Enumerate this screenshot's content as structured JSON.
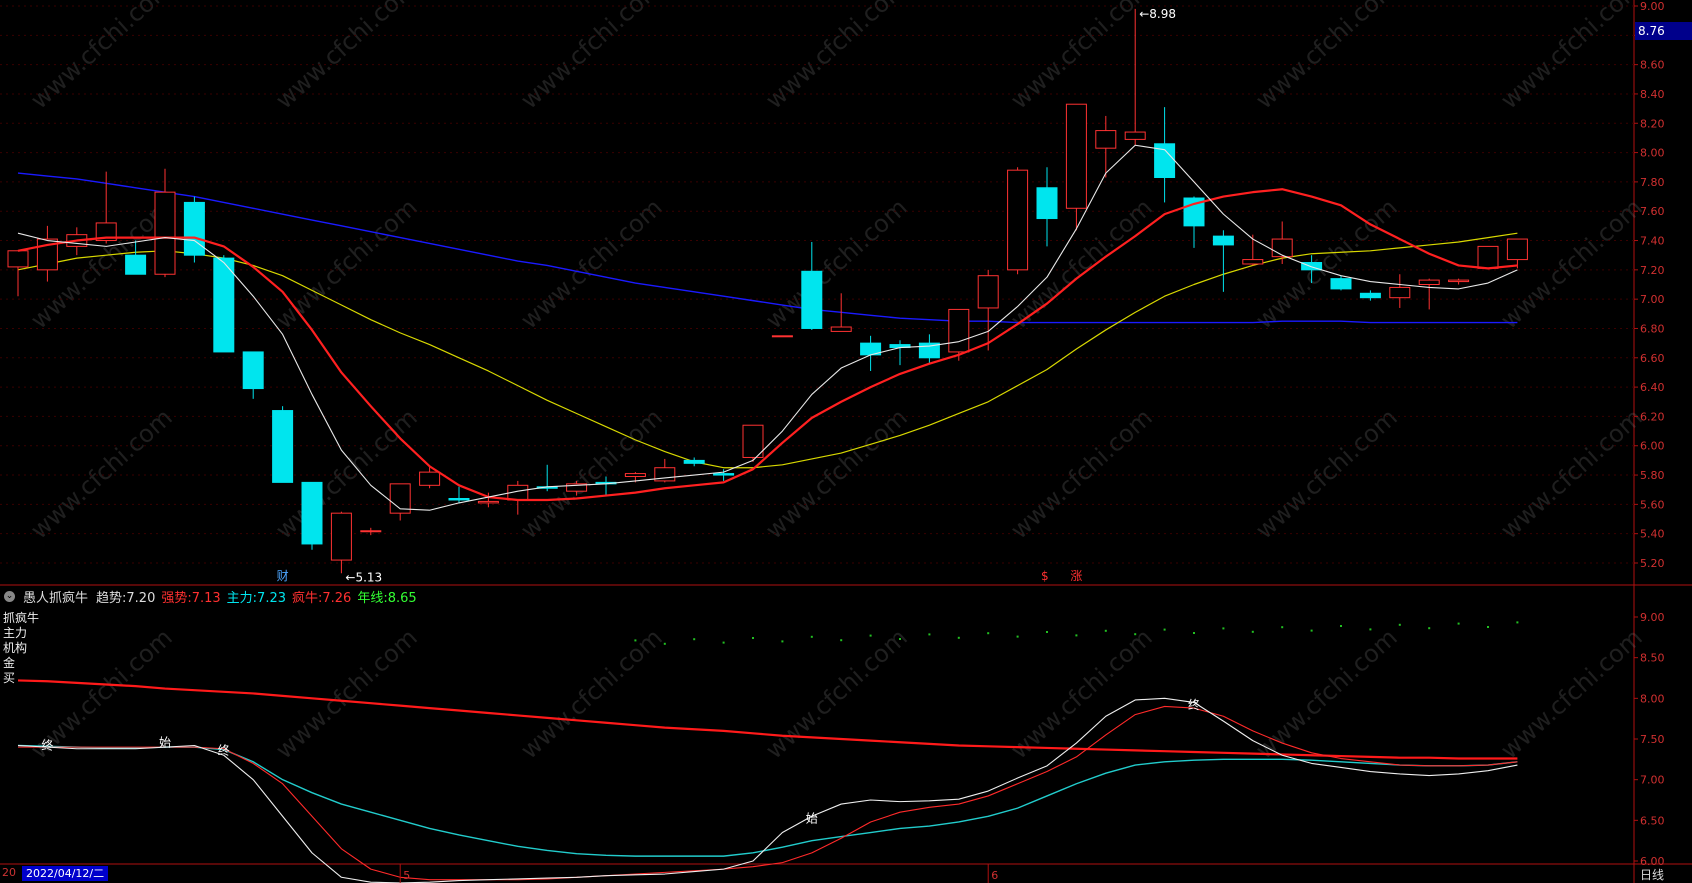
{
  "chart_data": [
    {
      "type": "candlestick",
      "period": "日线",
      "ylim": [
        5.0,
        9.0
      ],
      "y_ticks": [
        "9.00",
        "8.80",
        "8.60",
        "8.40",
        "8.20",
        "8.00",
        "7.80",
        "7.60",
        "7.40",
        "7.20",
        "7.00",
        "6.80",
        "6.60",
        "6.40",
        "6.20",
        "6.00",
        "5.80",
        "5.60",
        "5.40",
        "5.20"
      ],
      "current_price": "8.76",
      "colors": {
        "up": "#ff3232",
        "down": "#00e5ee",
        "ma_white": "#e8e8e8",
        "ma_red": "#ff2020",
        "ma_yellow": "#d8d800",
        "ma_blue": "#1a1aff",
        "axis": "#b01010"
      },
      "candles": [
        {
          "o": 7.22,
          "h": 7.33,
          "l": 7.02,
          "c": 7.33
        },
        {
          "o": 7.2,
          "h": 7.5,
          "l": 7.12,
          "c": 7.41
        },
        {
          "o": 7.36,
          "h": 7.49,
          "l": 7.3,
          "c": 7.44
        },
        {
          "o": 7.4,
          "h": 7.87,
          "l": 7.38,
          "c": 7.52
        },
        {
          "o": 7.3,
          "h": 7.4,
          "l": 7.17,
          "c": 7.17
        },
        {
          "o": 7.17,
          "h": 7.89,
          "l": 7.15,
          "c": 7.73
        },
        {
          "o": 7.66,
          "h": 7.7,
          "l": 7.25,
          "c": 7.3
        },
        {
          "o": 7.28,
          "h": 7.3,
          "l": 6.64,
          "c": 6.64
        },
        {
          "o": 6.64,
          "h": 6.64,
          "l": 6.32,
          "c": 6.39
        },
        {
          "o": 6.24,
          "h": 6.27,
          "l": 5.75,
          "c": 5.75
        },
        {
          "o": 5.75,
          "h": 5.75,
          "l": 5.29,
          "c": 5.33
        },
        {
          "o": 5.22,
          "h": 5.55,
          "l": 5.13,
          "c": 5.54
        },
        {
          "o": 5.42,
          "h": 5.44,
          "l": 5.39,
          "c": 5.42
        },
        {
          "o": 5.54,
          "h": 5.74,
          "l": 5.49,
          "c": 5.74
        },
        {
          "o": 5.73,
          "h": 5.86,
          "l": 5.71,
          "c": 5.82
        },
        {
          "o": 5.64,
          "h": 5.72,
          "l": 5.61,
          "c": 5.63
        },
        {
          "o": 5.61,
          "h": 5.68,
          "l": 5.58,
          "c": 5.62
        },
        {
          "o": 5.63,
          "h": 5.76,
          "l": 5.53,
          "c": 5.73
        },
        {
          "o": 5.72,
          "h": 5.87,
          "l": 5.69,
          "c": 5.71
        },
        {
          "o": 5.69,
          "h": 5.76,
          "l": 5.66,
          "c": 5.74
        },
        {
          "o": 5.75,
          "h": 5.79,
          "l": 5.66,
          "c": 5.74
        },
        {
          "o": 5.79,
          "h": 5.82,
          "l": 5.75,
          "c": 5.81
        },
        {
          "o": 5.76,
          "h": 5.91,
          "l": 5.75,
          "c": 5.85
        },
        {
          "o": 5.9,
          "h": 5.92,
          "l": 5.86,
          "c": 5.88
        },
        {
          "o": 5.81,
          "h": 5.84,
          "l": 5.76,
          "c": 5.8
        },
        {
          "o": 5.92,
          "h": 6.14,
          "l": 5.89,
          "c": 6.14
        },
        {
          "o": 6.75,
          "h": 6.75,
          "l": 6.75,
          "c": 6.75
        },
        {
          "o": 7.19,
          "h": 7.39,
          "l": 6.79,
          "c": 6.8
        },
        {
          "o": 6.78,
          "h": 7.04,
          "l": 6.78,
          "c": 6.81
        },
        {
          "o": 6.7,
          "h": 6.75,
          "l": 6.51,
          "c": 6.62
        },
        {
          "o": 6.69,
          "h": 6.72,
          "l": 6.55,
          "c": 6.67
        },
        {
          "o": 6.7,
          "h": 6.76,
          "l": 6.56,
          "c": 6.6
        },
        {
          "o": 6.64,
          "h": 6.93,
          "l": 6.58,
          "c": 6.93
        },
        {
          "o": 6.94,
          "h": 7.2,
          "l": 6.65,
          "c": 7.16
        },
        {
          "o": 7.2,
          "h": 7.9,
          "l": 7.17,
          "c": 7.88
        },
        {
          "o": 7.76,
          "h": 7.9,
          "l": 7.36,
          "c": 7.55
        },
        {
          "o": 7.62,
          "h": 8.33,
          "l": 7.47,
          "c": 8.33
        },
        {
          "o": 8.03,
          "h": 8.25,
          "l": 7.83,
          "c": 8.15
        },
        {
          "o": 8.09,
          "h": 8.98,
          "l": 8.05,
          "c": 8.14
        },
        {
          "o": 8.06,
          "h": 8.31,
          "l": 7.66,
          "c": 7.83
        },
        {
          "o": 7.69,
          "h": 7.7,
          "l": 7.35,
          "c": 7.5
        },
        {
          "o": 7.43,
          "h": 7.47,
          "l": 7.05,
          "c": 7.37
        },
        {
          "o": 7.24,
          "h": 7.44,
          "l": 7.23,
          "c": 7.27
        },
        {
          "o": 7.29,
          "h": 7.53,
          "l": 7.24,
          "c": 7.41
        },
        {
          "o": 7.25,
          "h": 7.3,
          "l": 7.11,
          "c": 7.2
        },
        {
          "o": 7.14,
          "h": 7.16,
          "l": 7.06,
          "c": 7.07
        },
        {
          "o": 7.04,
          "h": 7.06,
          "l": 6.99,
          "c": 7.01
        },
        {
          "o": 7.01,
          "h": 7.17,
          "l": 6.94,
          "c": 7.08
        },
        {
          "o": 7.1,
          "h": 7.14,
          "l": 6.93,
          "c": 7.13
        },
        {
          "o": 7.12,
          "h": 7.14,
          "l": 7.1,
          "c": 7.13
        },
        {
          "o": 7.21,
          "h": 7.36,
          "l": 7.21,
          "c": 7.36
        },
        {
          "o": 7.27,
          "h": 7.41,
          "l": 7.21,
          "c": 7.41
        }
      ],
      "ma_white": [
        7.45,
        7.4,
        7.38,
        7.36,
        7.39,
        7.42,
        7.4,
        7.25,
        7.02,
        6.76,
        6.35,
        5.97,
        5.73,
        5.57,
        5.56,
        5.61,
        5.65,
        5.69,
        5.72,
        5.73,
        5.74,
        5.76,
        5.78,
        5.8,
        5.82,
        5.9,
        6.1,
        6.35,
        6.53,
        6.62,
        6.67,
        6.68,
        6.71,
        6.78,
        6.95,
        7.15,
        7.48,
        7.86,
        8.05,
        8.02,
        7.8,
        7.58,
        7.41,
        7.3,
        7.22,
        7.16,
        7.12,
        7.1,
        7.08,
        7.07,
        7.11,
        7.2
      ],
      "ma_red": [
        7.33,
        7.37,
        7.4,
        7.42,
        7.42,
        7.42,
        7.42,
        7.36,
        7.22,
        7.05,
        6.79,
        6.5,
        6.27,
        6.05,
        5.86,
        5.73,
        5.65,
        5.63,
        5.63,
        5.64,
        5.66,
        5.68,
        5.71,
        5.73,
        5.75,
        5.84,
        6.02,
        6.19,
        6.3,
        6.4,
        6.49,
        6.56,
        6.62,
        6.7,
        6.83,
        6.97,
        7.14,
        7.29,
        7.43,
        7.58,
        7.65,
        7.7,
        7.73,
        7.75,
        7.7,
        7.64,
        7.51,
        7.41,
        7.31,
        7.23,
        7.21,
        7.23
      ],
      "ma_yellow": [
        7.2,
        7.24,
        7.28,
        7.3,
        7.32,
        7.33,
        7.31,
        7.28,
        7.23,
        7.16,
        7.06,
        6.96,
        6.86,
        6.77,
        6.69,
        6.6,
        6.51,
        6.41,
        6.31,
        6.22,
        6.13,
        6.04,
        5.96,
        5.89,
        5.85,
        5.85,
        5.87,
        5.91,
        5.95,
        6.01,
        6.07,
        6.14,
        6.22,
        6.3,
        6.41,
        6.52,
        6.66,
        6.79,
        6.91,
        7.02,
        7.1,
        7.17,
        7.23,
        7.28,
        7.31,
        7.32,
        7.33,
        7.35,
        7.37,
        7.39,
        7.42,
        7.45
      ],
      "ma_blue": [
        7.86,
        7.84,
        7.82,
        7.79,
        7.76,
        7.73,
        7.7,
        7.66,
        7.62,
        7.58,
        7.54,
        7.5,
        7.46,
        7.42,
        7.38,
        7.34,
        7.3,
        7.26,
        7.23,
        7.19,
        7.15,
        7.11,
        7.08,
        7.05,
        7.02,
        6.99,
        6.96,
        6.93,
        6.91,
        6.89,
        6.87,
        6.86,
        6.85,
        6.85,
        6.84,
        6.84,
        6.84,
        6.84,
        6.84,
        6.84,
        6.84,
        6.84,
        6.84,
        6.85,
        6.85,
        6.85,
        6.84,
        6.84,
        6.84,
        6.84,
        6.84,
        6.84
      ],
      "annotations": [
        {
          "label": "8.98",
          "index": 38,
          "value": 8.98,
          "type": "high"
        },
        {
          "label": "5.13",
          "index": 11,
          "value": 5.13,
          "type": "low"
        }
      ],
      "markers": [
        {
          "text": "财",
          "index": 9,
          "color": "#4da6ff"
        },
        {
          "text": "$",
          "index": 35,
          "color": "#ff3030"
        },
        {
          "text": "涨",
          "index": 36,
          "color": "#ff3030"
        }
      ]
    },
    {
      "type": "line",
      "name": "愚人抓疯牛",
      "ylim": [
        5.75,
        9.25
      ],
      "y_ticks": [
        "9.00",
        "8.50",
        "8.00",
        "7.50",
        "7.00",
        "6.50",
        "6.00"
      ],
      "legend": [
        {
          "label": "趋势:",
          "value": "7.20",
          "color": "#dddddd"
        },
        {
          "label": "强势:",
          "value": "7.13",
          "color": "#ff3030"
        },
        {
          "label": "主力:",
          "value": "7.23",
          "color": "#00e5ee"
        },
        {
          "label": "疯牛:",
          "value": "7.26",
          "color": "#ff3030"
        },
        {
          "label": "年线:",
          "value": "8.65",
          "color": "#33ff33"
        }
      ],
      "side_labels": [
        "抓疯牛",
        "主力",
        "机构",
        "金",
        "买"
      ],
      "series_white": [
        7.42,
        7.4,
        7.38,
        7.38,
        7.38,
        7.4,
        7.42,
        7.3,
        7.0,
        6.55,
        6.1,
        5.8,
        5.74,
        5.73,
        5.74,
        5.76,
        5.77,
        5.78,
        5.79,
        5.8,
        5.82,
        5.83,
        5.84,
        5.87,
        5.9,
        6.0,
        6.35,
        6.55,
        6.7,
        6.75,
        6.73,
        6.74,
        6.76,
        6.86,
        7.02,
        7.17,
        7.45,
        7.78,
        7.98,
        8.0,
        7.95,
        7.72,
        7.48,
        7.3,
        7.2,
        7.15,
        7.1,
        7.07,
        7.05,
        7.07,
        7.11,
        7.18
      ],
      "series_red": [
        7.4,
        7.4,
        7.4,
        7.4,
        7.4,
        7.4,
        7.4,
        7.38,
        7.2,
        6.95,
        6.55,
        6.15,
        5.9,
        5.8,
        5.77,
        5.77,
        5.77,
        5.77,
        5.78,
        5.8,
        5.82,
        5.84,
        5.86,
        5.88,
        5.9,
        5.93,
        5.98,
        6.1,
        6.28,
        6.48,
        6.6,
        6.66,
        6.7,
        6.8,
        6.95,
        7.1,
        7.28,
        7.55,
        7.8,
        7.9,
        7.88,
        7.78,
        7.6,
        7.45,
        7.33,
        7.26,
        7.22,
        7.18,
        7.17,
        7.17,
        7.18,
        7.22
      ],
      "series_cyan": [
        7.42,
        7.41,
        7.4,
        7.39,
        7.39,
        7.4,
        7.4,
        7.37,
        7.22,
        7.0,
        6.84,
        6.7,
        6.6,
        6.5,
        6.4,
        6.32,
        6.25,
        6.18,
        6.13,
        6.09,
        6.07,
        6.06,
        6.06,
        6.06,
        6.06,
        6.1,
        6.17,
        6.25,
        6.3,
        6.35,
        6.4,
        6.43,
        6.48,
        6.55,
        6.65,
        6.8,
        6.95,
        7.08,
        7.18,
        7.22,
        7.24,
        7.25,
        7.25,
        7.25,
        7.24,
        7.22,
        7.2,
        7.18,
        7.17,
        7.17,
        7.18,
        7.22
      ],
      "series_thick": [
        8.22,
        8.21,
        8.19,
        8.17,
        8.15,
        8.12,
        8.1,
        8.08,
        8.06,
        8.03,
        8.0,
        7.97,
        7.94,
        7.91,
        7.88,
        7.85,
        7.82,
        7.79,
        7.76,
        7.73,
        7.7,
        7.67,
        7.64,
        7.62,
        7.6,
        7.57,
        7.54,
        7.52,
        7.5,
        7.48,
        7.46,
        7.44,
        7.42,
        7.41,
        7.4,
        7.39,
        7.38,
        7.37,
        7.36,
        7.35,
        7.34,
        7.33,
        7.32,
        7.31,
        7.3,
        7.29,
        7.28,
        7.27,
        7.27,
        7.26,
        7.26,
        7.26
      ],
      "dots_green_start": 21,
      "dots_green_value": 8.7,
      "text_markers": [
        {
          "text": "终",
          "index": 1,
          "value": 7.42
        },
        {
          "text": "始",
          "index": 5,
          "value": 7.46
        },
        {
          "text": "终",
          "index": 7,
          "value": 7.36
        },
        {
          "text": "始",
          "index": 27,
          "value": 6.52
        },
        {
          "text": "终",
          "index": 40,
          "value": 7.92
        }
      ]
    }
  ],
  "footer": {
    "date": "2022/04/12/二",
    "left_mark": "20",
    "month_marks": [
      {
        "text": "5",
        "index": 13
      },
      {
        "text": "6",
        "index": 33
      }
    ],
    "period": "日线"
  },
  "watermark": "www.cfchi.com"
}
